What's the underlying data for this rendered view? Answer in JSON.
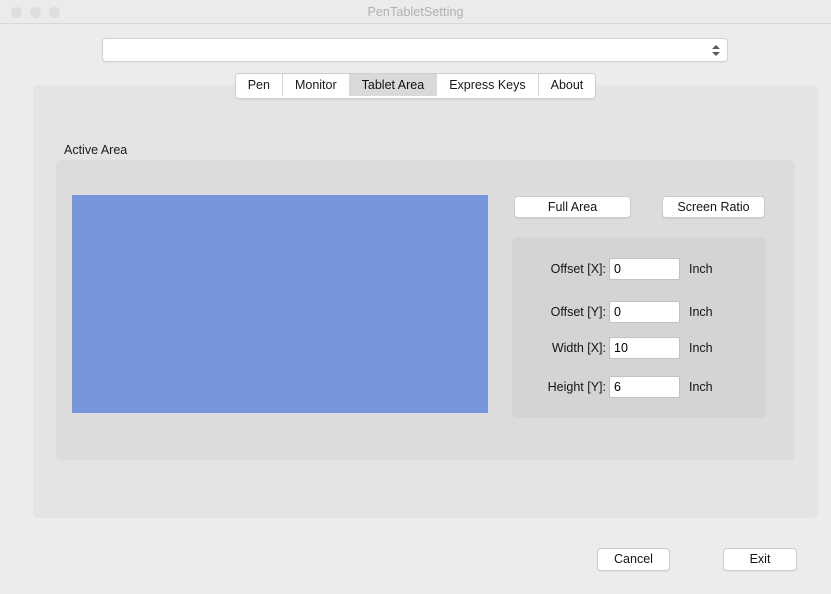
{
  "window": {
    "title": "PenTabletSetting",
    "traffic_lights": [
      "close",
      "minimize",
      "zoom"
    ]
  },
  "device_selector": {
    "value": "",
    "placeholder": ""
  },
  "tabs": [
    {
      "label": "Pen",
      "selected": false
    },
    {
      "label": "Monitor",
      "selected": false
    },
    {
      "label": "Tablet Area",
      "selected": true
    },
    {
      "label": "Express Keys",
      "selected": false
    },
    {
      "label": "About",
      "selected": false
    }
  ],
  "active_area": {
    "group_label": "Active Area",
    "preview_color": "#7795da",
    "buttons": {
      "full_area": "Full Area",
      "screen_ratio": "Screen Ratio"
    },
    "fields": [
      {
        "label": "Offset [X]:",
        "value": "0",
        "unit": "Inch"
      },
      {
        "label": "Offset [Y]:",
        "value": "0",
        "unit": "Inch"
      },
      {
        "label": "Width [X]:",
        "value": "10",
        "unit": "Inch"
      },
      {
        "label": "Height [Y]:",
        "value": "6",
        "unit": "Inch"
      }
    ]
  },
  "footer": {
    "cancel": "Cancel",
    "exit": "Exit"
  },
  "colors": {
    "window_background": "#ececec",
    "titlebar": "#ebebeb",
    "tab_panel": "#e4e4e4",
    "group_panel": "#dcdcdc",
    "field_panel": "#d4d4d4",
    "preview_blue": "#7795da",
    "selected_tab": "#d9d9d9"
  }
}
